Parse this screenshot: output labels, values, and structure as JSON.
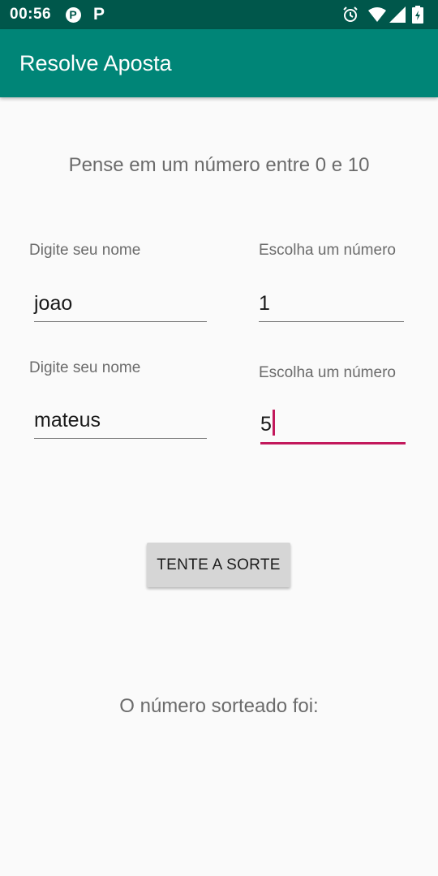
{
  "status_bar": {
    "time": "00:56",
    "icons": [
      "pinterest-icon",
      "p-app-icon",
      "alarm-icon",
      "wifi-icon",
      "signal-icon",
      "battery-icon"
    ]
  },
  "app_bar": {
    "title": "Resolve Aposta",
    "color": "#008577"
  },
  "main": {
    "instruction": "Pense em um número entre 0 e 10",
    "players": [
      {
        "name_label": "Digite seu nome",
        "name_value": "joao",
        "number_label": "Escolha um número",
        "number_value": "1"
      },
      {
        "name_label": "Digite seu nome",
        "name_value": "mateus",
        "number_label": "Escolha um número",
        "number_value": "5"
      }
    ],
    "button_label": "TENTE A SORTE",
    "result_text": "O número sorteado foi:"
  },
  "colors": {
    "status_bar": "#00574b",
    "accent": "#c2185b",
    "background": "#fafafa"
  }
}
